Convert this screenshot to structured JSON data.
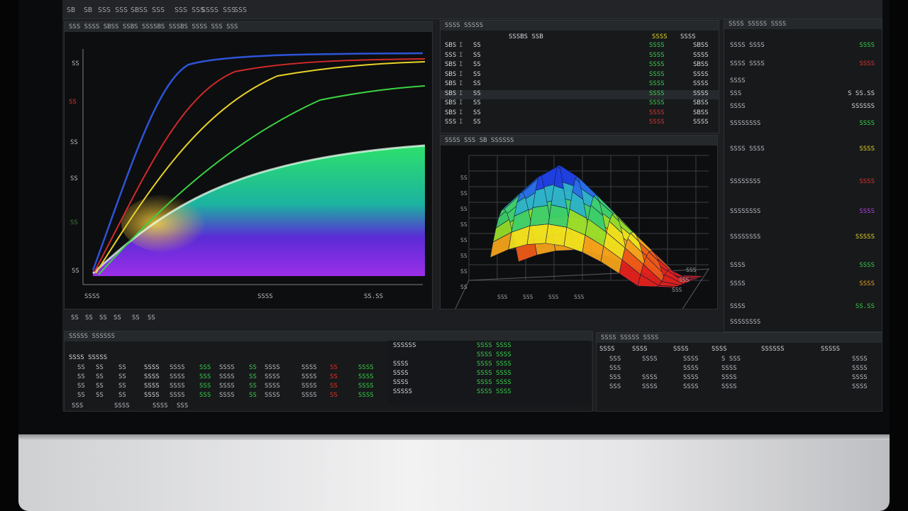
{
  "menubar": {
    "items": [
      "SB",
      "SB",
      "SSS SSS",
      "SBSS SSS",
      "SSS SSS",
      "SSSS SSS",
      "SSS"
    ]
  },
  "left_panel": {
    "title": "SSS SSSS SBSS SSBS SSSSBS SSSBS SSSS SSS SSS",
    "y_ticks": [
      "SS",
      "SS",
      "SS",
      "SS",
      "SS",
      "SS"
    ],
    "x_ticks": [
      "SSSS",
      "SSSS",
      "SS.SS"
    ],
    "footer": [
      "SS",
      "SS",
      "SS",
      "SS",
      "SS",
      "SS"
    ]
  },
  "top_table": {
    "title": "SSSS SSSSS",
    "header_left": "SSSBS SSB",
    "header_right": [
      "SSSS",
      "SSSS"
    ],
    "rows": [
      {
        "id": "SBS",
        "n": "SS",
        "a": "SSSS",
        "b": "SBSS"
      },
      {
        "id": "SSS",
        "n": "SS",
        "a": "SSSS",
        "b": "SSSS"
      },
      {
        "id": "SBS",
        "n": "SS",
        "a": "SSSS",
        "b": "SBSS"
      },
      {
        "id": "SBS",
        "n": "SS",
        "a": "SSSS",
        "b": "SSSS"
      },
      {
        "id": "SBS",
        "n": "SS",
        "a": "SSSS",
        "b": "SSSS"
      },
      {
        "id": "SBS",
        "n": "SS",
        "a": "SSSS",
        "b": "SSSS"
      },
      {
        "id": "SBS",
        "n": "SS",
        "a": "SSSS",
        "b": "SBSS"
      },
      {
        "id": "SBS",
        "n": "SS",
        "a": "SSSS",
        "b": "SBSS"
      },
      {
        "id": "SSS",
        "n": "SS",
        "a": "SSSS",
        "b": "SSSS"
      }
    ]
  },
  "surface_panel": {
    "title": "SSSS SSS SB SSSSSS",
    "y_ticks": [
      "SS",
      "SS",
      "SS",
      "SS",
      "SS",
      "SS",
      "SS",
      "SS"
    ],
    "x_ticks": [
      "SSS",
      "SSS",
      "SSS",
      "SSS"
    ],
    "z_ticks": [
      "SSS",
      "SSS",
      "SSS"
    ]
  },
  "right_panel": {
    "title": "SSSS SSSSS SSSS",
    "items": [
      {
        "label": "SSSS SSSS",
        "value": "SSSS",
        "color": "#39d04a"
      },
      {
        "label": "SSSS SSSS",
        "value": "SSSS",
        "color": "#e2322e"
      },
      {
        "label": "SSSS",
        "value": "",
        "color": "#b8bcc2"
      },
      {
        "label": "SSS",
        "value": "S SS.SS",
        "color": "#d5d8dc"
      },
      {
        "label": "SSSS",
        "value": "SSSSSS",
        "color": "#d5d8dc"
      },
      {
        "label": "SSSSSSSS",
        "value": "SSSS",
        "color": "#39d04a"
      },
      {
        "label": "SSSS SSSS",
        "value": "SSSS",
        "color": "#e3d52a"
      },
      {
        "label": "SSSSSSSS",
        "value": "SSSS",
        "color": "#e2322e"
      },
      {
        "label": "SSSSSSSS",
        "value": "SSSS",
        "color": "#b640e6"
      },
      {
        "label": "SSSSSSSS",
        "value": "SSSSS",
        "color": "#e3d52a"
      },
      {
        "label": "SSSS",
        "value": "SSSS",
        "color": "#39d04a"
      },
      {
        "label": "SSSS",
        "value": "SSSS",
        "color": "#e8a11d"
      },
      {
        "label": "SSSS",
        "value": "SS.SS",
        "color": "#39d04a"
      },
      {
        "label": "SSSSSSSS",
        "value": "",
        "color": "#b8bcc2"
      }
    ]
  },
  "bottom_left": {
    "title": "SSSSS SSSSSS",
    "subtitle": "SSSS SSSSS",
    "rows": [
      [
        "SS",
        "SS",
        "SS",
        "SSSS",
        "SSSS",
        "SSS",
        "SSSS",
        "SS",
        "SSSS",
        "SSSS",
        "SS",
        "SSSS"
      ],
      [
        "SS",
        "SS",
        "SS",
        "SSSS",
        "SSSS",
        "SSS",
        "SSSS",
        "SS",
        "SSSS",
        "SSSS",
        "SS",
        "SSSS"
      ],
      [
        "SS",
        "SS",
        "SS",
        "SSSS",
        "SSSS",
        "SSS",
        "SSSS",
        "SS",
        "SSSS",
        "SSSS",
        "SS",
        "SSSS"
      ],
      [
        "SS",
        "SS",
        "SS",
        "SSSS",
        "SSSS",
        "SSS",
        "SSSS",
        "SS",
        "SSSS",
        "SSSS",
        "SS",
        "SSSS"
      ]
    ],
    "footer": [
      "SSS",
      "SSSS",
      "SSSS",
      "SSS"
    ]
  },
  "bottom_mid": {
    "rows": [
      {
        "label": "SSSSSS",
        "value": "SSSS SSSS"
      },
      {
        "label": "",
        "value": "SSSS SSSS"
      },
      {
        "label": "SSSS",
        "value": "SSSS SSSS"
      },
      {
        "label": "SSSS",
        "value": "SSSS SSSS"
      },
      {
        "label": "SSSS",
        "value": "SSSS SSSS"
      },
      {
        "label": "SSSSS",
        "value": "SSSS SSSS"
      }
    ]
  },
  "bottom_right": {
    "title": "SSSS SSSSS SSSS",
    "headers": [
      "SSSS",
      "SSSS",
      "SSSS",
      "SSSS",
      "SSSSSS",
      "SSSSS"
    ],
    "rows": [
      [
        "SSS",
        "SSSS",
        "SSSS",
        "S SSS",
        "",
        "SSSS"
      ],
      [
        "SSS",
        "",
        "SSSS",
        "SSSS",
        "",
        "SSSS"
      ],
      [
        "SSS",
        "SSSS",
        "SSSS",
        "SSSS",
        "",
        "SSSS"
      ],
      [
        "SSS",
        "SSSS",
        "SSSS",
        "SSSS",
        "",
        "SSSS"
      ]
    ]
  }
}
